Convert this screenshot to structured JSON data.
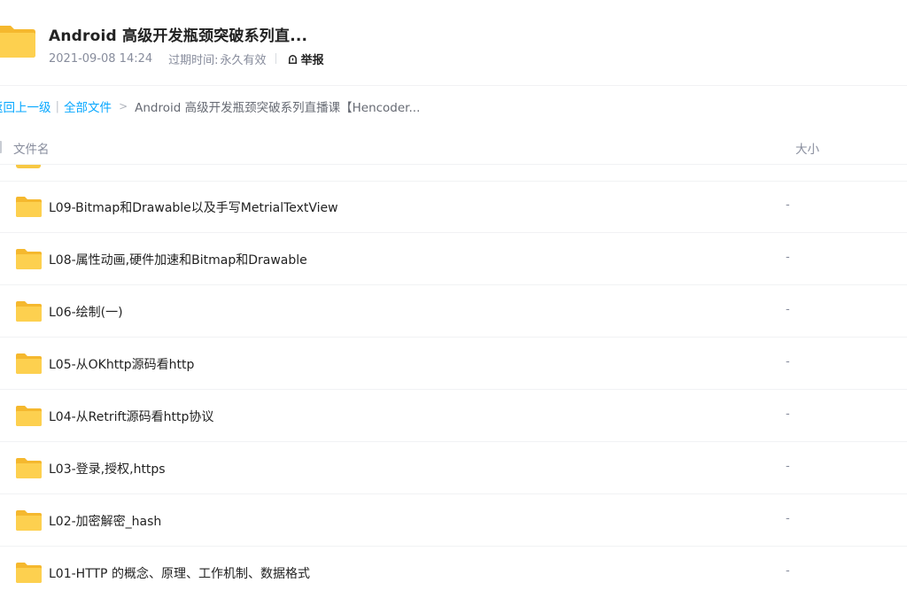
{
  "share": {
    "title": "Android 高级开发瓶颈突破系列直...",
    "date": "2021-09-08 14:24",
    "expire_label": "过期时间:",
    "expire_value": "永久有效",
    "report_label": "举报"
  },
  "breadcrumb": {
    "up": "返回上一级",
    "all_files": "全部文件",
    "separator": "|",
    "arrow": ">",
    "current": "Android 高级开发瓶颈突破系列直播课【Hencoder..."
  },
  "table": {
    "col_name": "文件名",
    "col_size": "大小"
  },
  "files": [
    {
      "name": "L09-Bitmap和Drawable以及手写MetrialTextView",
      "size": "-"
    },
    {
      "name": "L08-属性动画,硬件加速和Bitmap和Drawable",
      "size": "-"
    },
    {
      "name": "L06-绘制(一)",
      "size": "-"
    },
    {
      "name": "L05-从OKhttp源码看http",
      "size": "-"
    },
    {
      "name": "L04-从Retrift源码看http协议",
      "size": "-"
    },
    {
      "name": "L03-登录,授权,https",
      "size": "-"
    },
    {
      "name": "L02-加密解密_hash",
      "size": "-"
    },
    {
      "name": "L01-HTTP 的概念、原理、工作机制、数据格式",
      "size": "-"
    }
  ],
  "icons": {
    "folder": "folder-icon",
    "report": "report-icon"
  },
  "colors": {
    "link": "#06a7ff",
    "folder": "#f7c843",
    "muted": "#878c9c"
  }
}
